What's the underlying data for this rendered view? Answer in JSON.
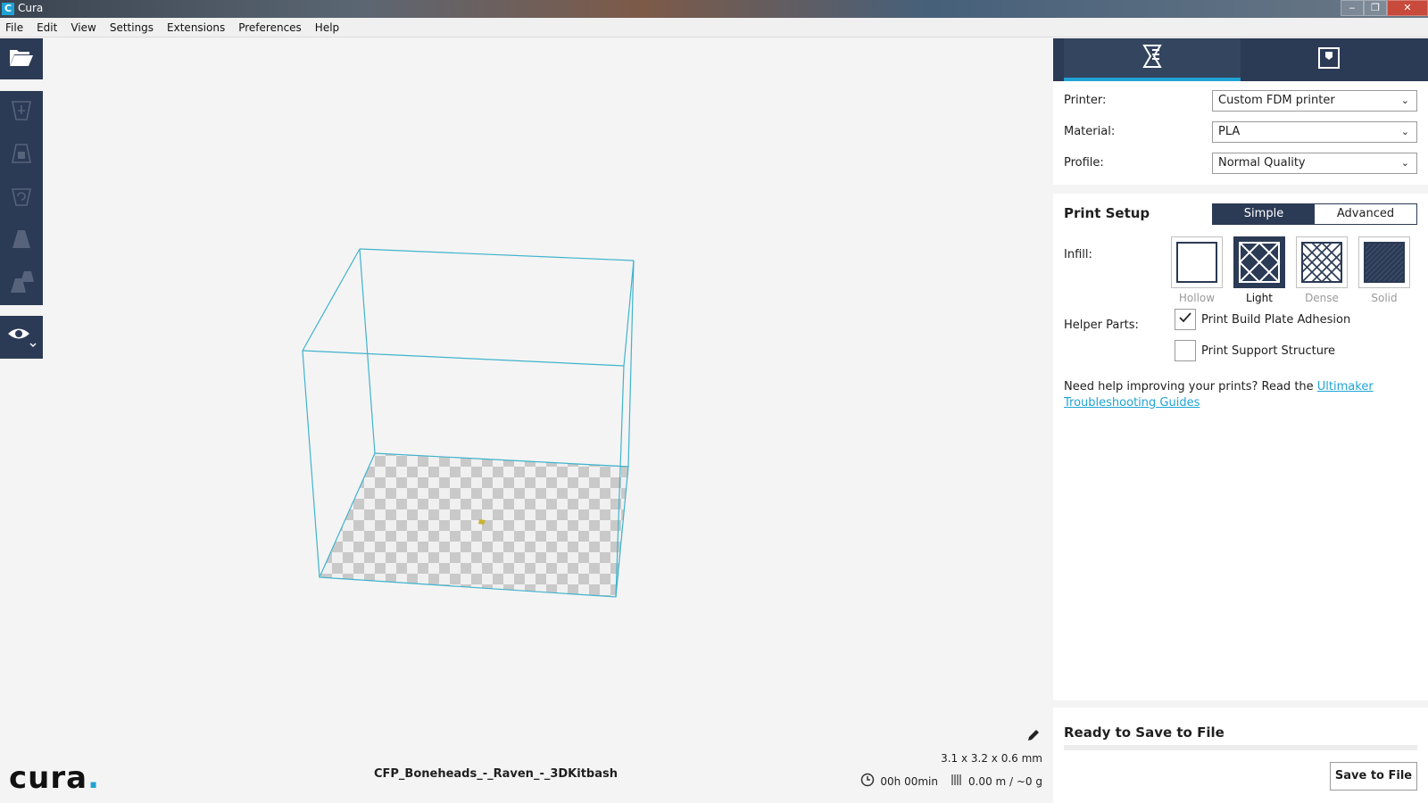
{
  "window": {
    "title": "Cura",
    "app_icon": "C",
    "buttons": [
      "‒",
      "❐",
      "✕"
    ]
  },
  "menu": [
    "File",
    "Edit",
    "View",
    "Settings",
    "Extensions",
    "Preferences",
    "Help"
  ],
  "left_toolbar": {
    "open_icon": "folder-open-icon",
    "tools": [
      "translate-icon",
      "scale-icon",
      "rotate-icon",
      "mirror-icon",
      "per-model-settings-icon"
    ],
    "view_icon": "eye-icon"
  },
  "viewport": {
    "job_name": "CFP_Boneheads_-_Raven_-_3DKitbash",
    "dimensions": "3.1 x 3.2 x 0.6 mm",
    "time": "00h 00min",
    "material_usage": "0.00 m / ~0 g",
    "logo": "cura",
    "logo_dot": ".",
    "colors": {
      "volume_outline": "#3fb3cc",
      "plate_light": "#f0f0f0",
      "plate_dark": "#c9c9c9",
      "model": "#c9b234"
    }
  },
  "sidebar": {
    "tabs": [
      {
        "icon": "print-setup-icon",
        "active": true
      },
      {
        "icon": "monitor-icon",
        "active": false
      }
    ],
    "printer": {
      "label": "Printer:",
      "value": "Custom FDM printer"
    },
    "material": {
      "label": "Material:",
      "value": "PLA"
    },
    "profile": {
      "label": "Profile:",
      "value": "Normal Quality"
    },
    "print_setup": {
      "title": "Print Setup",
      "modes": [
        "Simple",
        "Advanced"
      ],
      "active_mode": "Simple",
      "infill_label": "Infill:",
      "infill_options": [
        "Hollow",
        "Light",
        "Dense",
        "Solid"
      ],
      "infill_selected": "Light",
      "helper_label": "Helper Parts:",
      "adhesion": {
        "label": "Print Build Plate Adhesion",
        "checked": true
      },
      "support": {
        "label": "Print Support Structure",
        "checked": false
      },
      "help_text": "Need help improving your prints? Read the ",
      "help_link": "Ultimaker Troubleshooting Guides"
    },
    "ready_text": "Ready to Save to File",
    "save_button": "Save to File",
    "colors": {
      "primary": "#2b3a55",
      "accent": "#1fa3d4"
    }
  }
}
